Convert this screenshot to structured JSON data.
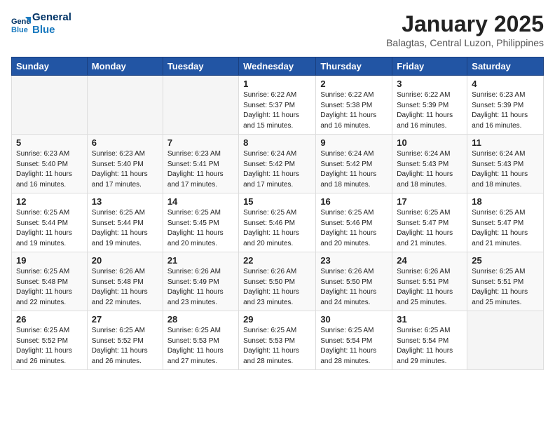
{
  "header": {
    "logo_line1": "General",
    "logo_line2": "Blue",
    "month": "January 2025",
    "location": "Balagtas, Central Luzon, Philippines"
  },
  "weekdays": [
    "Sunday",
    "Monday",
    "Tuesday",
    "Wednesday",
    "Thursday",
    "Friday",
    "Saturday"
  ],
  "weeks": [
    [
      {
        "day": "",
        "info": ""
      },
      {
        "day": "",
        "info": ""
      },
      {
        "day": "",
        "info": ""
      },
      {
        "day": "1",
        "info": "Sunrise: 6:22 AM\nSunset: 5:37 PM\nDaylight: 11 hours\nand 15 minutes."
      },
      {
        "day": "2",
        "info": "Sunrise: 6:22 AM\nSunset: 5:38 PM\nDaylight: 11 hours\nand 16 minutes."
      },
      {
        "day": "3",
        "info": "Sunrise: 6:22 AM\nSunset: 5:39 PM\nDaylight: 11 hours\nand 16 minutes."
      },
      {
        "day": "4",
        "info": "Sunrise: 6:23 AM\nSunset: 5:39 PM\nDaylight: 11 hours\nand 16 minutes."
      }
    ],
    [
      {
        "day": "5",
        "info": "Sunrise: 6:23 AM\nSunset: 5:40 PM\nDaylight: 11 hours\nand 16 minutes."
      },
      {
        "day": "6",
        "info": "Sunrise: 6:23 AM\nSunset: 5:40 PM\nDaylight: 11 hours\nand 17 minutes."
      },
      {
        "day": "7",
        "info": "Sunrise: 6:23 AM\nSunset: 5:41 PM\nDaylight: 11 hours\nand 17 minutes."
      },
      {
        "day": "8",
        "info": "Sunrise: 6:24 AM\nSunset: 5:42 PM\nDaylight: 11 hours\nand 17 minutes."
      },
      {
        "day": "9",
        "info": "Sunrise: 6:24 AM\nSunset: 5:42 PM\nDaylight: 11 hours\nand 18 minutes."
      },
      {
        "day": "10",
        "info": "Sunrise: 6:24 AM\nSunset: 5:43 PM\nDaylight: 11 hours\nand 18 minutes."
      },
      {
        "day": "11",
        "info": "Sunrise: 6:24 AM\nSunset: 5:43 PM\nDaylight: 11 hours\nand 18 minutes."
      }
    ],
    [
      {
        "day": "12",
        "info": "Sunrise: 6:25 AM\nSunset: 5:44 PM\nDaylight: 11 hours\nand 19 minutes."
      },
      {
        "day": "13",
        "info": "Sunrise: 6:25 AM\nSunset: 5:44 PM\nDaylight: 11 hours\nand 19 minutes."
      },
      {
        "day": "14",
        "info": "Sunrise: 6:25 AM\nSunset: 5:45 PM\nDaylight: 11 hours\nand 20 minutes."
      },
      {
        "day": "15",
        "info": "Sunrise: 6:25 AM\nSunset: 5:46 PM\nDaylight: 11 hours\nand 20 minutes."
      },
      {
        "day": "16",
        "info": "Sunrise: 6:25 AM\nSunset: 5:46 PM\nDaylight: 11 hours\nand 20 minutes."
      },
      {
        "day": "17",
        "info": "Sunrise: 6:25 AM\nSunset: 5:47 PM\nDaylight: 11 hours\nand 21 minutes."
      },
      {
        "day": "18",
        "info": "Sunrise: 6:25 AM\nSunset: 5:47 PM\nDaylight: 11 hours\nand 21 minutes."
      }
    ],
    [
      {
        "day": "19",
        "info": "Sunrise: 6:25 AM\nSunset: 5:48 PM\nDaylight: 11 hours\nand 22 minutes."
      },
      {
        "day": "20",
        "info": "Sunrise: 6:26 AM\nSunset: 5:48 PM\nDaylight: 11 hours\nand 22 minutes."
      },
      {
        "day": "21",
        "info": "Sunrise: 6:26 AM\nSunset: 5:49 PM\nDaylight: 11 hours\nand 23 minutes."
      },
      {
        "day": "22",
        "info": "Sunrise: 6:26 AM\nSunset: 5:50 PM\nDaylight: 11 hours\nand 23 minutes."
      },
      {
        "day": "23",
        "info": "Sunrise: 6:26 AM\nSunset: 5:50 PM\nDaylight: 11 hours\nand 24 minutes."
      },
      {
        "day": "24",
        "info": "Sunrise: 6:26 AM\nSunset: 5:51 PM\nDaylight: 11 hours\nand 25 minutes."
      },
      {
        "day": "25",
        "info": "Sunrise: 6:25 AM\nSunset: 5:51 PM\nDaylight: 11 hours\nand 25 minutes."
      }
    ],
    [
      {
        "day": "26",
        "info": "Sunrise: 6:25 AM\nSunset: 5:52 PM\nDaylight: 11 hours\nand 26 minutes."
      },
      {
        "day": "27",
        "info": "Sunrise: 6:25 AM\nSunset: 5:52 PM\nDaylight: 11 hours\nand 26 minutes."
      },
      {
        "day": "28",
        "info": "Sunrise: 6:25 AM\nSunset: 5:53 PM\nDaylight: 11 hours\nand 27 minutes."
      },
      {
        "day": "29",
        "info": "Sunrise: 6:25 AM\nSunset: 5:53 PM\nDaylight: 11 hours\nand 28 minutes."
      },
      {
        "day": "30",
        "info": "Sunrise: 6:25 AM\nSunset: 5:54 PM\nDaylight: 11 hours\nand 28 minutes."
      },
      {
        "day": "31",
        "info": "Sunrise: 6:25 AM\nSunset: 5:54 PM\nDaylight: 11 hours\nand 29 minutes."
      },
      {
        "day": "",
        "info": ""
      }
    ]
  ]
}
